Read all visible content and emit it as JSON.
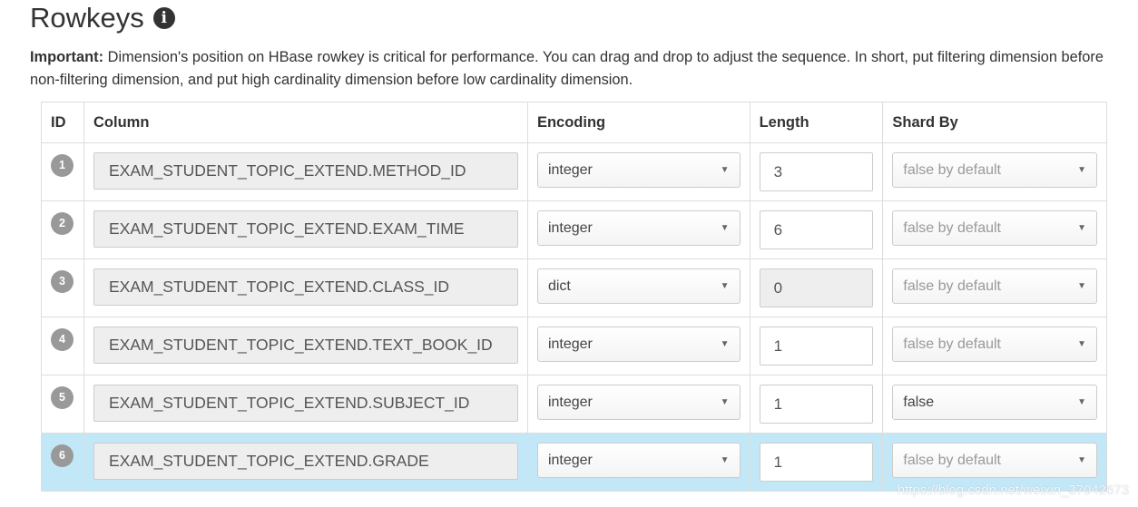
{
  "header": {
    "title": "Rowkeys",
    "note_strong": "Important:",
    "note_text": "Dimension's position on HBase rowkey is critical for performance. You can drag and drop to adjust the sequence. In short, put filtering dimension before non-filtering dimension, and put high cardinality dimension before low cardinality dimension."
  },
  "table": {
    "headers": [
      "ID",
      "Column",
      "Encoding",
      "Length",
      "Shard By"
    ],
    "rows": [
      {
        "id": "1",
        "column": "EXAM_STUDENT_TOPIC_EXTEND.METHOD_ID",
        "encoding": "integer",
        "length": "3",
        "shard_by": "false by default"
      },
      {
        "id": "2",
        "column": "EXAM_STUDENT_TOPIC_EXTEND.EXAM_TIME",
        "encoding": "integer",
        "length": "6",
        "shard_by": "false by default"
      },
      {
        "id": "3",
        "column": "EXAM_STUDENT_TOPIC_EXTEND.CLASS_ID",
        "encoding": "dict",
        "length": "0",
        "shard_by": "false by default"
      },
      {
        "id": "4",
        "column": "EXAM_STUDENT_TOPIC_EXTEND.TEXT_BOOK_ID",
        "encoding": "integer",
        "length": "1",
        "shard_by": "false by default"
      },
      {
        "id": "5",
        "column": "EXAM_STUDENT_TOPIC_EXTEND.SUBJECT_ID",
        "encoding": "integer",
        "length": "1",
        "shard_by": "false"
      },
      {
        "id": "6",
        "column": "EXAM_STUDENT_TOPIC_EXTEND.GRADE",
        "encoding": "integer",
        "length": "1",
        "shard_by": "false by default"
      }
    ]
  },
  "icons": {
    "info": "info-circle-icon",
    "caret": "caret-down-icon"
  },
  "colors": {
    "selected_row": "#c2e8f8",
    "badge": "#999999"
  },
  "watermark": "https://blog.csdn.net/weixin_37042673"
}
